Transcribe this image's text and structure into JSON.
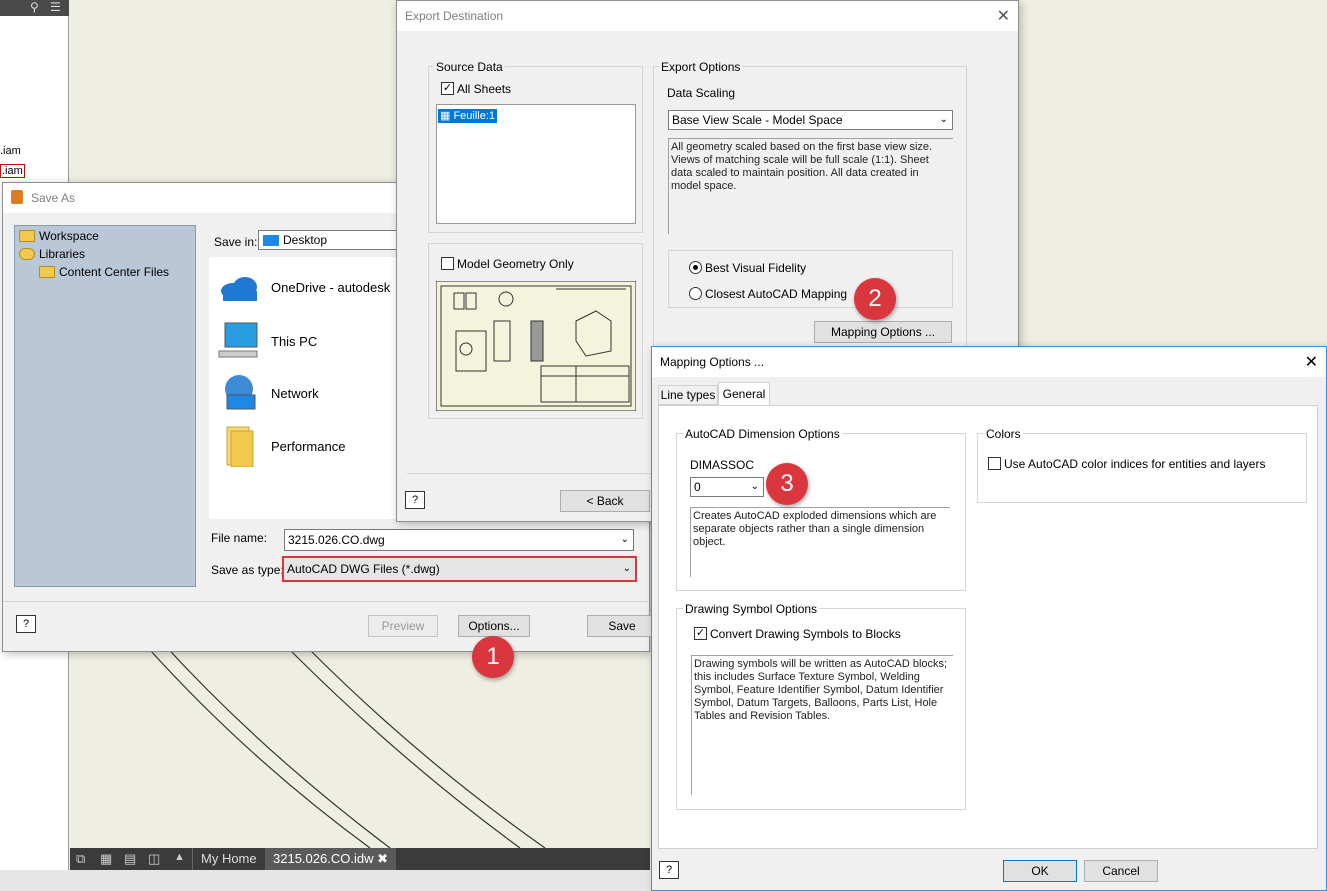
{
  "background": {
    "left_files": [
      ".iam",
      ".iam"
    ],
    "bottom_tabs": [
      "My Home",
      "3215.026.CO.idw"
    ]
  },
  "save_as": {
    "title": "Save As",
    "tree": [
      "Workspace",
      "Libraries",
      "Content Center Files"
    ],
    "save_in_label": "Save in:",
    "save_in_value": "Desktop",
    "places": [
      "OneDrive - autodesk",
      "This PC",
      "Network",
      "Performance"
    ],
    "file_name_label": "File name:",
    "file_name_value": "3215.026.CO.dwg",
    "save_type_label": "Save as type:",
    "save_type_value": "AutoCAD DWG Files (*.dwg)",
    "preview_label": "Preview",
    "options_label": "Options...",
    "save_label": "Save",
    "help": "?"
  },
  "export": {
    "title": "Export Destination",
    "source_data": "Source Data",
    "all_sheets": "All Sheets",
    "sheet_item": "Feuille:1",
    "model_geometry": "Model Geometry Only",
    "export_options": "Export Options",
    "data_scaling": "Data Scaling",
    "scaling_value": "Base View Scale - Model Space",
    "scaling_desc": "All geometry scaled based on the first base view size. Views of matching scale will be full scale (1:1). Sheet data scaled to maintain position. All data created in model space.",
    "best_fidelity": "Best Visual Fidelity",
    "closest_mapping": "Closest AutoCAD Mapping",
    "mapping_button": "Mapping Options ...",
    "back_label": "< Back",
    "help": "?"
  },
  "mapping": {
    "title": "Mapping Options ...",
    "tabs": [
      "Line types",
      "General"
    ],
    "dim_group": "AutoCAD Dimension Options",
    "dimassoc_label": "DIMASSOC",
    "dimassoc_value": "0",
    "dim_desc": "Creates AutoCAD exploded dimensions which are separate objects rather than a single dimension object.",
    "colors_group": "Colors",
    "colors_check": "Use AutoCAD color indices for entities and layers",
    "symbol_group": "Drawing Symbol Options",
    "symbol_check": "Convert Drawing Symbols to Blocks",
    "symbol_desc": "Drawing symbols will be written as AutoCAD blocks; this includes Surface Texture Symbol, Welding Symbol, Feature Identifier Symbol, Datum Identifier Symbol, Datum Targets, Balloons, Parts List, Hole Tables and Revision Tables.",
    "ok_label": "OK",
    "cancel_label": "Cancel",
    "help": "?"
  },
  "badges": [
    "1",
    "2",
    "3"
  ]
}
